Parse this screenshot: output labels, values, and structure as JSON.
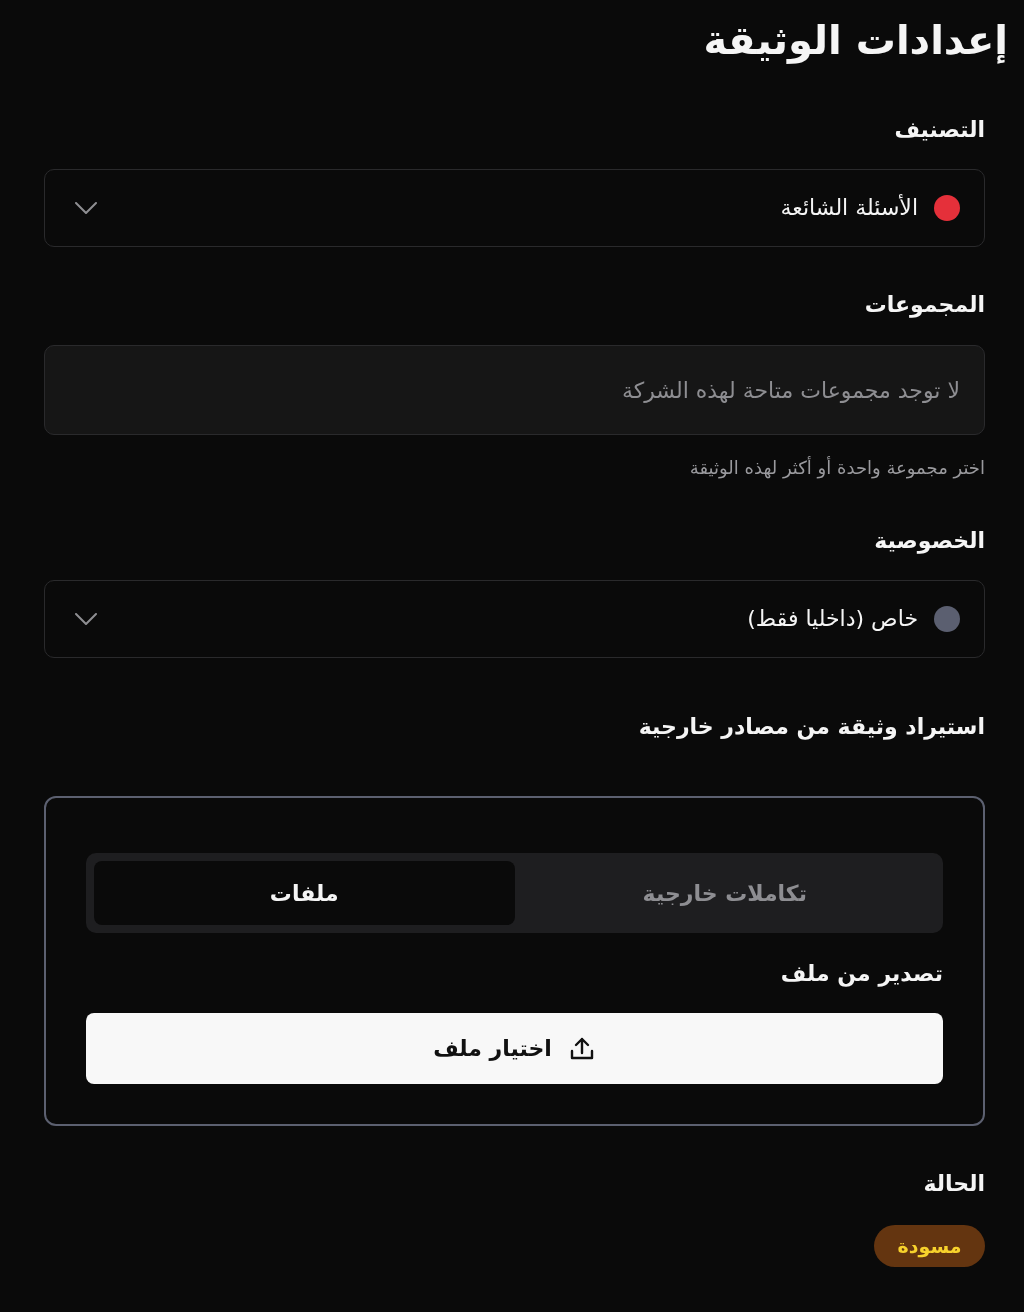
{
  "title": "إعدادات الوثيقة",
  "category": {
    "label": "التصنيف",
    "value": "الأسئلة الشائعة",
    "color": "#e5303a"
  },
  "groups": {
    "label": "المجموعات",
    "placeholder": "لا توجد مجموعات متاحة لهذه الشركة",
    "hint": "اختر مجموعة واحدة أو أكثر لهذه الوثيقة"
  },
  "privacy": {
    "label": "الخصوصية",
    "value": "خاص (داخليا فقط)",
    "color": "#5b5f70"
  },
  "import": {
    "label": "استيراد وثيقة من مصادر خارجية",
    "tabs": [
      {
        "label": "تكاملات خارجية",
        "selected": false
      },
      {
        "label": "ملفات",
        "selected": true
      }
    ],
    "section_label": "تصدير من ملف",
    "button": "اختيار ملف"
  },
  "status": {
    "label": "الحالة",
    "badge": "مسودة"
  }
}
